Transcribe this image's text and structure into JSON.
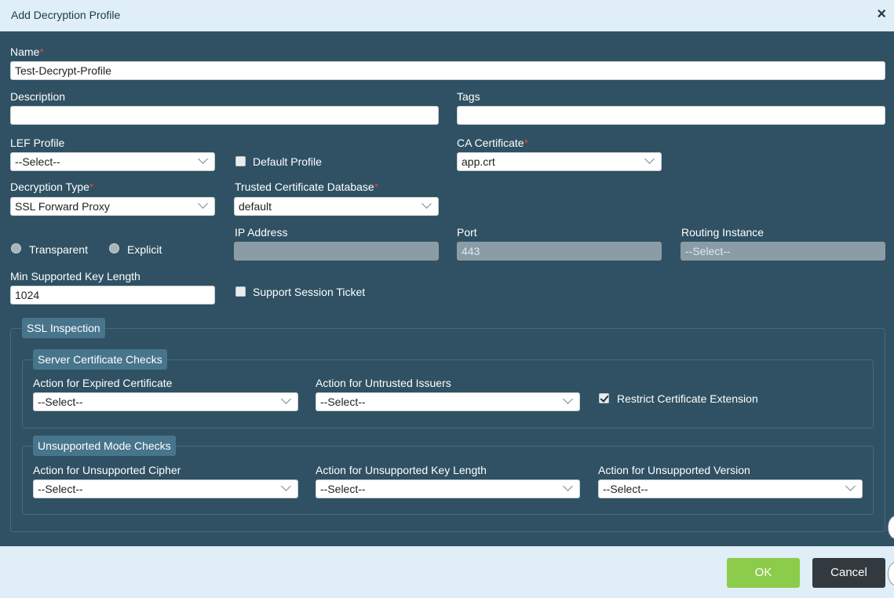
{
  "dialog": {
    "title": "Add Decryption Profile",
    "close_icon": "×"
  },
  "name": {
    "label": "Name",
    "required_mark": "*",
    "value": "Test-Decrypt-Profile"
  },
  "description": {
    "label": "Description",
    "value": ""
  },
  "tags": {
    "label": "Tags",
    "value": ""
  },
  "lef_profile": {
    "label": "LEF Profile",
    "value": "--Select--"
  },
  "default_profile": {
    "label": "Default Profile",
    "checked": false
  },
  "ca_certificate": {
    "label": "CA Certificate",
    "required_mark": "*",
    "value": "app.crt"
  },
  "decryption_type": {
    "label": "Decryption Type",
    "required_mark": "*",
    "value": "SSL Forward Proxy"
  },
  "trusted_cert_db": {
    "label": "Trusted Certificate Database",
    "required_mark": "*",
    "value": "default"
  },
  "mode": {
    "transparent_label": "Transparent",
    "explicit_label": "Explicit"
  },
  "ip_address": {
    "label": "IP Address",
    "value": ""
  },
  "port": {
    "label": "Port",
    "value": "443"
  },
  "routing_instance": {
    "label": "Routing Instance",
    "value": "--Select--"
  },
  "min_key_length": {
    "label": "Min Supported Key Length",
    "value": "1024"
  },
  "support_session_ticket": {
    "label": "Support Session Ticket",
    "checked": false
  },
  "ssl_inspection": {
    "legend": "SSL Inspection",
    "server_checks": {
      "legend": "Server Certificate Checks",
      "expired": {
        "label": "Action for Expired Certificate",
        "value": "--Select--"
      },
      "untrusted": {
        "label": "Action for Untrusted Issuers",
        "value": "--Select--"
      },
      "restrict_ext": {
        "label": "Restrict Certificate Extension",
        "checked": true
      }
    },
    "unsupported_checks": {
      "legend": "Unsupported Mode Checks",
      "cipher": {
        "label": "Action for Unsupported Cipher",
        "value": "--Select--"
      },
      "key_length": {
        "label": "Action for Unsupported Key Length",
        "value": "--Select--"
      },
      "version": {
        "label": "Action for Unsupported Version",
        "value": "--Select--"
      }
    }
  },
  "footer": {
    "ok_label": "OK",
    "cancel_label": "Cancel"
  },
  "colors": {
    "header_bg": "#dfeef7",
    "body_bg": "#2f5163",
    "ok_green": "#8ccc4a",
    "cancel_dark": "#323a3f",
    "required_red": "#e0473a"
  }
}
